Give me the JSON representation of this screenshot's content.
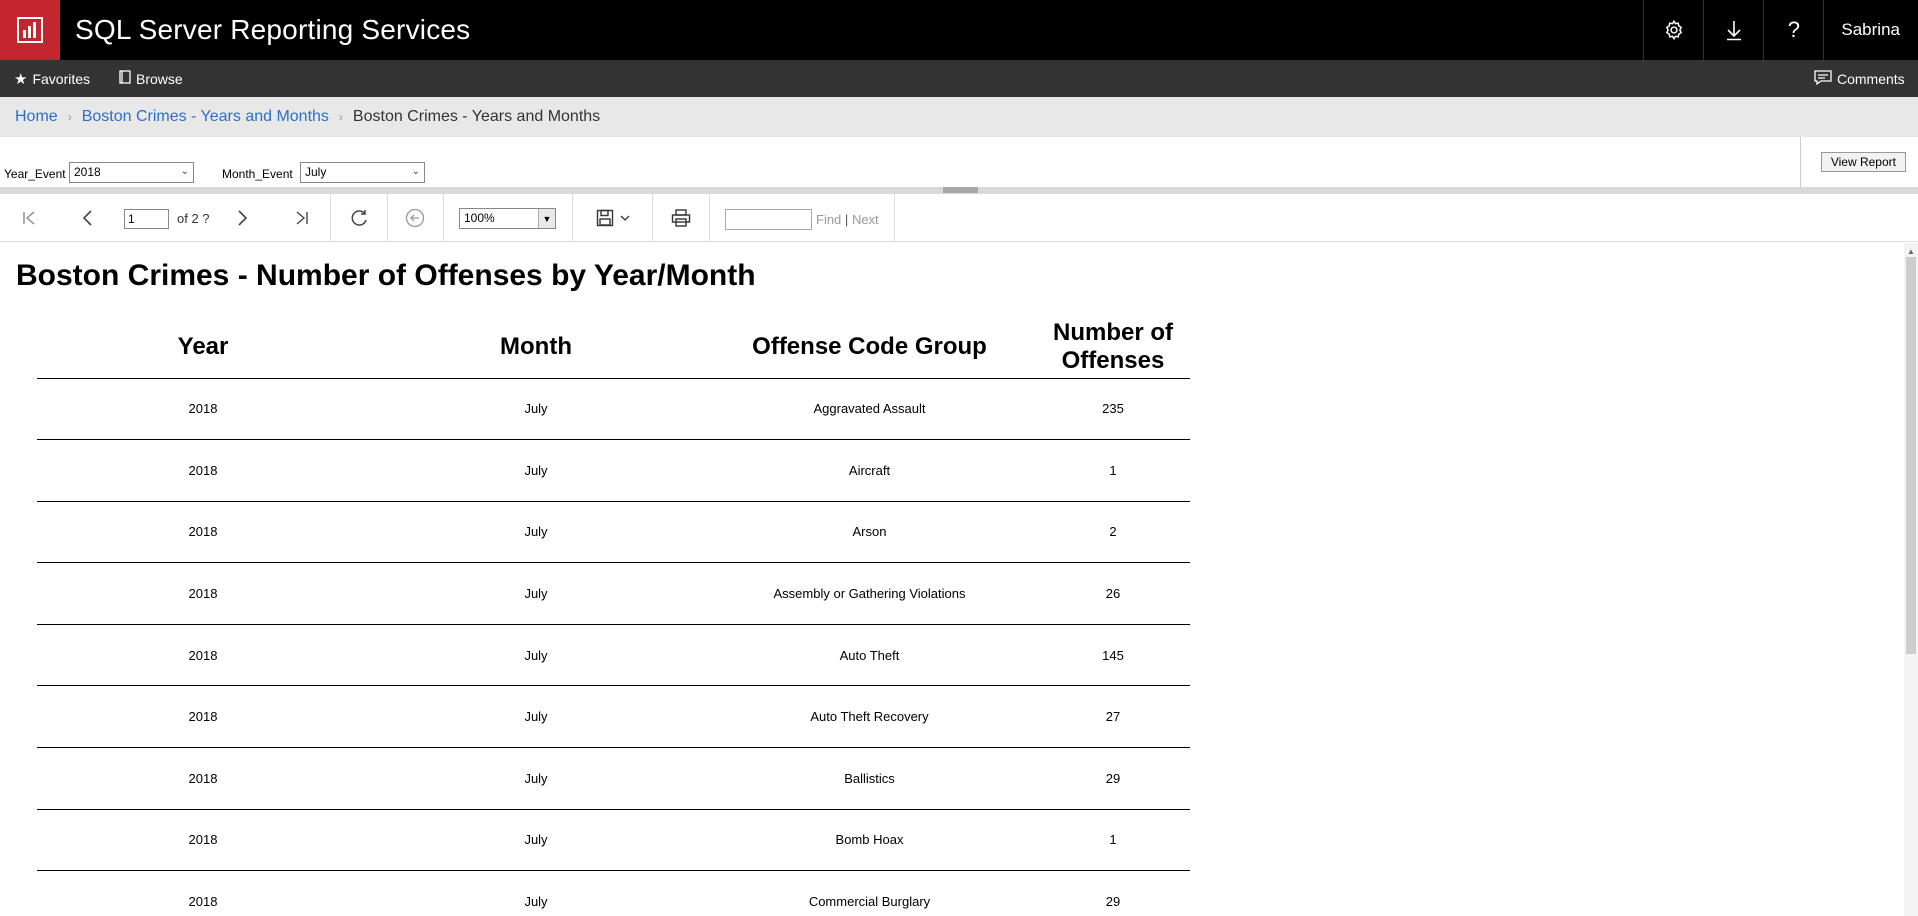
{
  "header": {
    "app_title": "SQL Server Reporting Services",
    "user": "Sabrina",
    "icons": [
      "settings-gear-icon",
      "download-icon",
      "help-icon"
    ]
  },
  "nav": {
    "favorites": "Favorites",
    "browse": "Browse",
    "comments": "Comments"
  },
  "breadcrumb": {
    "home": "Home",
    "folder": "Boston Crimes - Years and Months",
    "current": "Boston Crimes - Years and Months"
  },
  "params": {
    "year_label": "Year_Event",
    "year_value": "2018",
    "month_label": "Month_Event",
    "month_value": "July",
    "view_report": "View Report"
  },
  "toolbar": {
    "page_number": "1",
    "page_of": "of 2 ?",
    "zoom": "100%",
    "find": "Find",
    "find_sep": "|",
    "next": "Next"
  },
  "report": {
    "title": "Boston Crimes - Number of Offenses by Year/Month",
    "columns": [
      "Year",
      "Month",
      "Offense Code Group",
      "Number of Offenses"
    ],
    "rows": [
      [
        "2018",
        "July",
        "Aggravated Assault",
        "235"
      ],
      [
        "2018",
        "July",
        "Aircraft",
        "1"
      ],
      [
        "2018",
        "July",
        "Arson",
        "2"
      ],
      [
        "2018",
        "July",
        "Assembly or Gathering Violations",
        "26"
      ],
      [
        "2018",
        "July",
        "Auto Theft",
        "145"
      ],
      [
        "2018",
        "July",
        "Auto Theft Recovery",
        "27"
      ],
      [
        "2018",
        "July",
        "Ballistics",
        "29"
      ],
      [
        "2018",
        "July",
        "Bomb Hoax",
        "1"
      ],
      [
        "2018",
        "July",
        "Commercial Burglary",
        "29"
      ]
    ]
  },
  "colors": {
    "brand_red": "#c4262e",
    "header_bg": "#000000",
    "nav_bg": "#333333",
    "link": "#2b6fc9"
  }
}
